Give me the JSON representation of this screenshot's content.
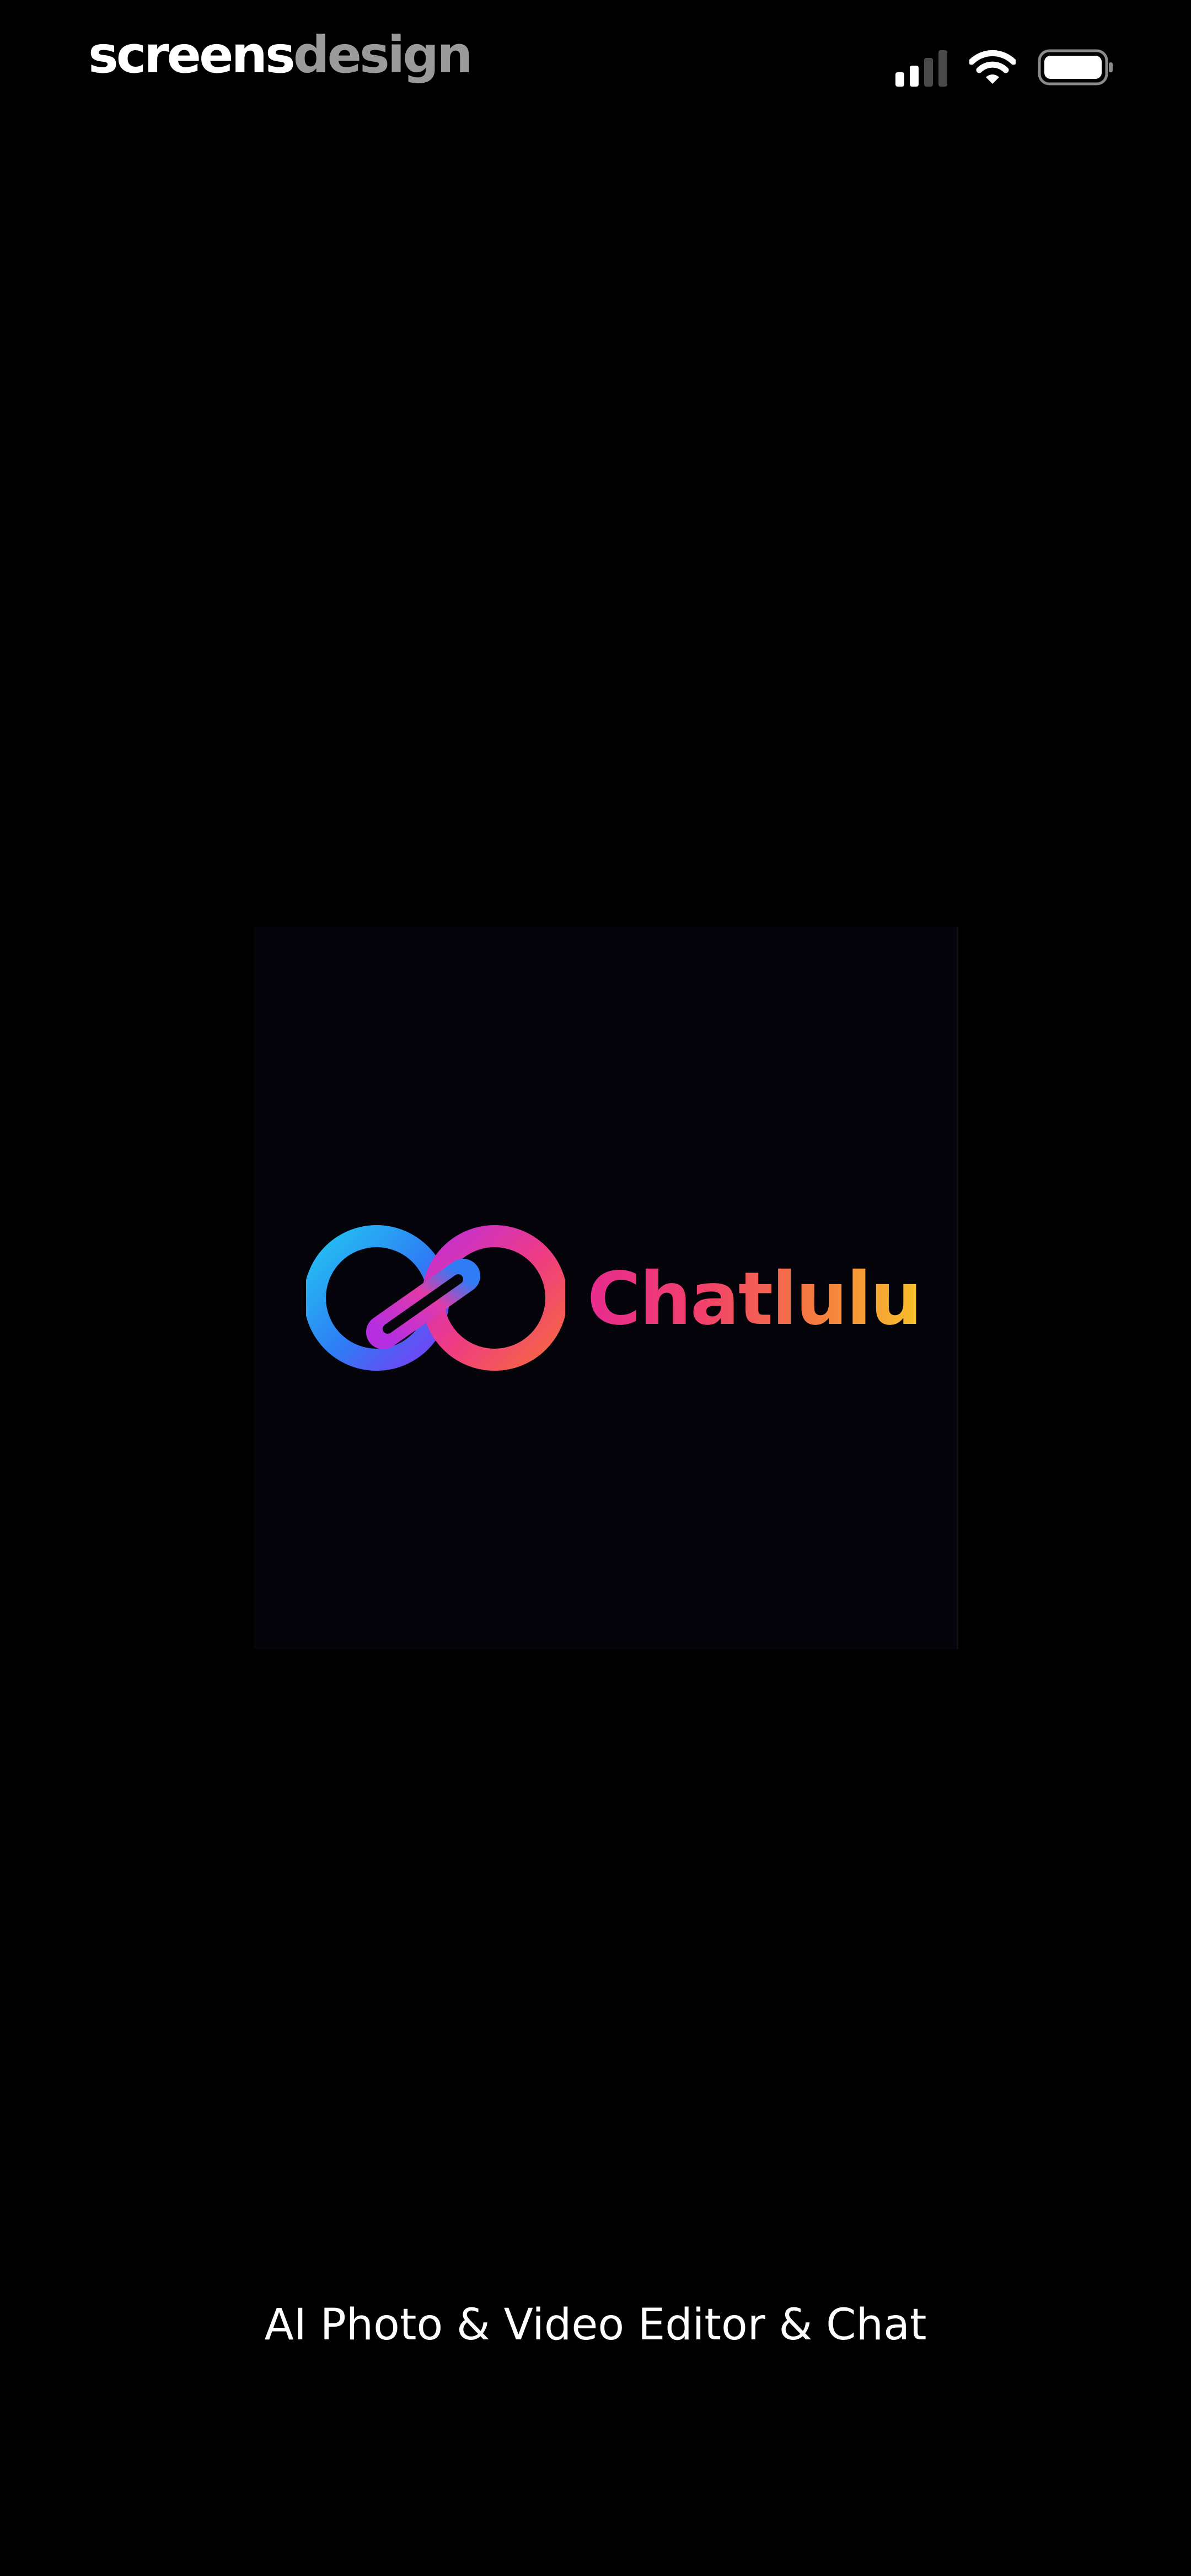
{
  "watermark": {
    "part1": "screens",
    "part2": "design"
  },
  "status_bar": {
    "signal_icon": "cellular-signal-icon",
    "signal_bars_active": 2,
    "signal_bars_total": 4,
    "wifi_icon": "wifi-icon",
    "battery_icon": "battery-icon",
    "battery_level": 1.0
  },
  "app": {
    "name": "Chatlulu",
    "tagline": "AI Photo & Video Editor & Chat",
    "logo_icon": "infinity-link-logo-icon"
  },
  "colors": {
    "background": "#000000",
    "brand_gradient": [
      "#e62b8f",
      "#f2416a",
      "#f57f3d",
      "#f8c12b"
    ],
    "logo_blue": "#19b7f0",
    "logo_violet": "#7a3cf5",
    "logo_magenta": "#e8317f"
  }
}
